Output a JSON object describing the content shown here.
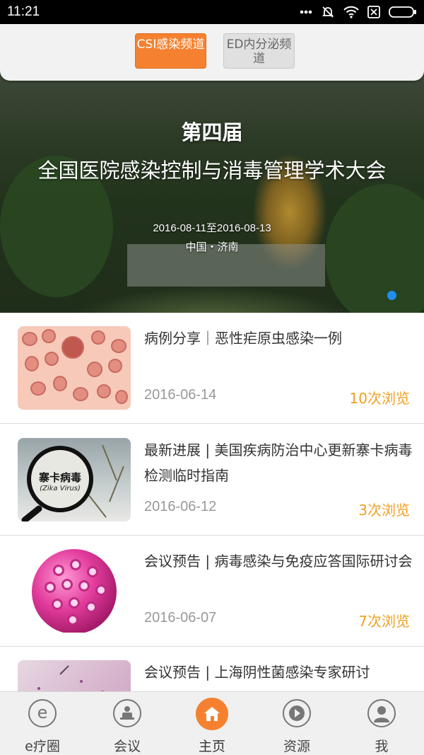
{
  "status_bar": {
    "time": "11:21",
    "icons": [
      "more-dots-icon",
      "bell-off-icon",
      "wifi-icon",
      "sim-x-icon",
      "battery-icon"
    ]
  },
  "channels": [
    {
      "label": "CSI感染频道",
      "active": true
    },
    {
      "label": "ED内分泌频道",
      "active": false
    }
  ],
  "banner": {
    "ordinal": "第四届",
    "title": "全国医院感染控制与消毒管理学术大会",
    "date": "2016-08-11至2016-08-13",
    "location": "中国・济南"
  },
  "articles": [
    {
      "title": "病例分享｜恶性疟原虫感染一例",
      "date": "2016-06-14",
      "views": "10次浏览",
      "thumb_text": ""
    },
    {
      "title": "最新进展 | 美国疾病防治中心更新寨卡病毒检测临时指南",
      "date": "2016-06-12",
      "views": "3次浏览",
      "thumb_text": "寨卡病毒",
      "thumb_subtext": "(Zika Virus)"
    },
    {
      "title": "会议预告 | 病毒感染与免疫应答国际研讨会",
      "date": "2016-06-07",
      "views": "7次浏览"
    },
    {
      "title": "会议预告 | 上海阴性菌感染专家研讨",
      "date": "",
      "views": ""
    }
  ],
  "bottom_nav": [
    {
      "label": "e疗圈",
      "icon": "e-circle-icon",
      "active": false
    },
    {
      "label": "会议",
      "icon": "meeting-person-icon",
      "active": false
    },
    {
      "label": "主页",
      "icon": "home-icon",
      "active": true
    },
    {
      "label": "资源",
      "icon": "play-icon",
      "active": false
    },
    {
      "label": "我",
      "icon": "user-icon",
      "active": false
    }
  ],
  "colors": {
    "accent": "#f58130",
    "views": "#f0a020",
    "dot": "#1e8ff0"
  }
}
